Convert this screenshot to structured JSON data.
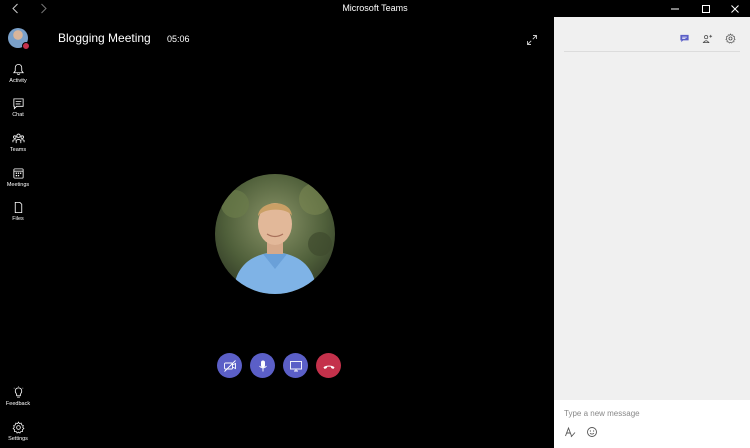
{
  "window": {
    "title": "Microsoft Teams"
  },
  "rail": {
    "items": [
      {
        "label": "Activity",
        "icon": "bell-icon"
      },
      {
        "label": "Chat",
        "icon": "chat-icon"
      },
      {
        "label": "Teams",
        "icon": "teams-icon"
      },
      {
        "label": "Meetings",
        "icon": "calendar-icon"
      },
      {
        "label": "Files",
        "icon": "file-icon"
      }
    ],
    "bottom": [
      {
        "label": "Feedback",
        "icon": "lightbulb-icon"
      },
      {
        "label": "Settings",
        "icon": "gear-icon"
      }
    ]
  },
  "meeting": {
    "title": "Blogging Meeting",
    "duration": "05:06"
  },
  "colors": {
    "accent": "#5b5fc7",
    "hangup": "#c4314b",
    "stage": "#000000",
    "panel": "#f0f0f0"
  },
  "compose": {
    "placeholder": "Type a new message"
  }
}
